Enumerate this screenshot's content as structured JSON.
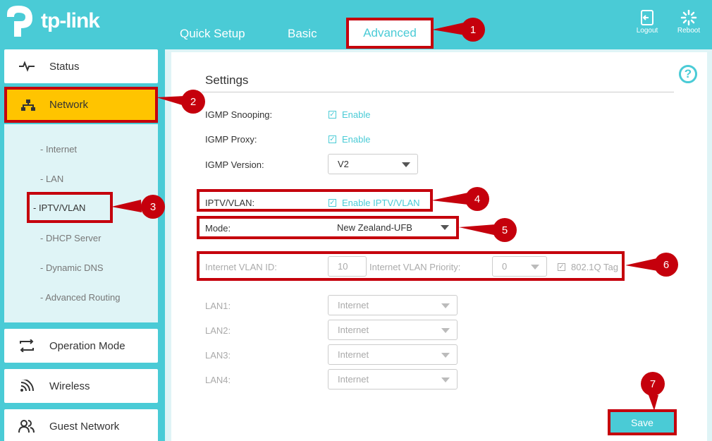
{
  "brand": {
    "name": "tp-link"
  },
  "nav": {
    "tabs": [
      "Quick Setup",
      "Basic",
      "Advanced"
    ],
    "active": "Advanced",
    "logout_label": "Logout",
    "reboot_label": "Reboot"
  },
  "sidebar": {
    "items": [
      {
        "label": "Status",
        "icon": "pulse-icon"
      },
      {
        "label": "Network",
        "icon": "network-icon"
      },
      {
        "label": "Operation Mode",
        "icon": "switch-icon"
      },
      {
        "label": "Wireless",
        "icon": "wifi-icon"
      },
      {
        "label": "Guest Network",
        "icon": "users-icon"
      }
    ],
    "active": "Network",
    "submenu": [
      "Internet",
      "LAN",
      "IPTV/VLAN",
      "DHCP Server",
      "Dynamic DNS",
      "Advanced Routing"
    ],
    "submenu_active": "IPTV/VLAN"
  },
  "settings": {
    "title": "Settings",
    "igmp_snooping": {
      "label": "IGMP Snooping:",
      "checkbox": "Enable",
      "checked": true
    },
    "igmp_proxy": {
      "label": "IGMP Proxy:",
      "checkbox": "Enable",
      "checked": true
    },
    "igmp_version": {
      "label": "IGMP Version:",
      "value": "V2"
    },
    "iptv_vlan": {
      "label": "IPTV/VLAN:",
      "checkbox": "Enable IPTV/VLAN",
      "checked": true
    },
    "mode": {
      "label": "Mode:",
      "value": "New Zealand-UFB"
    },
    "internet_vlan_id": {
      "label": "Internet VLAN ID:",
      "value": "10"
    },
    "internet_vlan_priority": {
      "label": "Internet VLAN Priority:",
      "value": "0"
    },
    "tag_8021q": {
      "label": "802.1Q Tag",
      "checked": true
    },
    "lan_ports": [
      {
        "label": "LAN1:",
        "value": "Internet"
      },
      {
        "label": "LAN2:",
        "value": "Internet"
      },
      {
        "label": "LAN3:",
        "value": "Internet"
      },
      {
        "label": "LAN4:",
        "value": "Internet"
      }
    ],
    "save_label": "Save"
  },
  "callouts": [
    "1",
    "2",
    "3",
    "4",
    "5",
    "6",
    "7"
  ],
  "colors": {
    "accent": "#4acbd6",
    "highlight": "#ffc400",
    "annotation": "#c5000c"
  }
}
